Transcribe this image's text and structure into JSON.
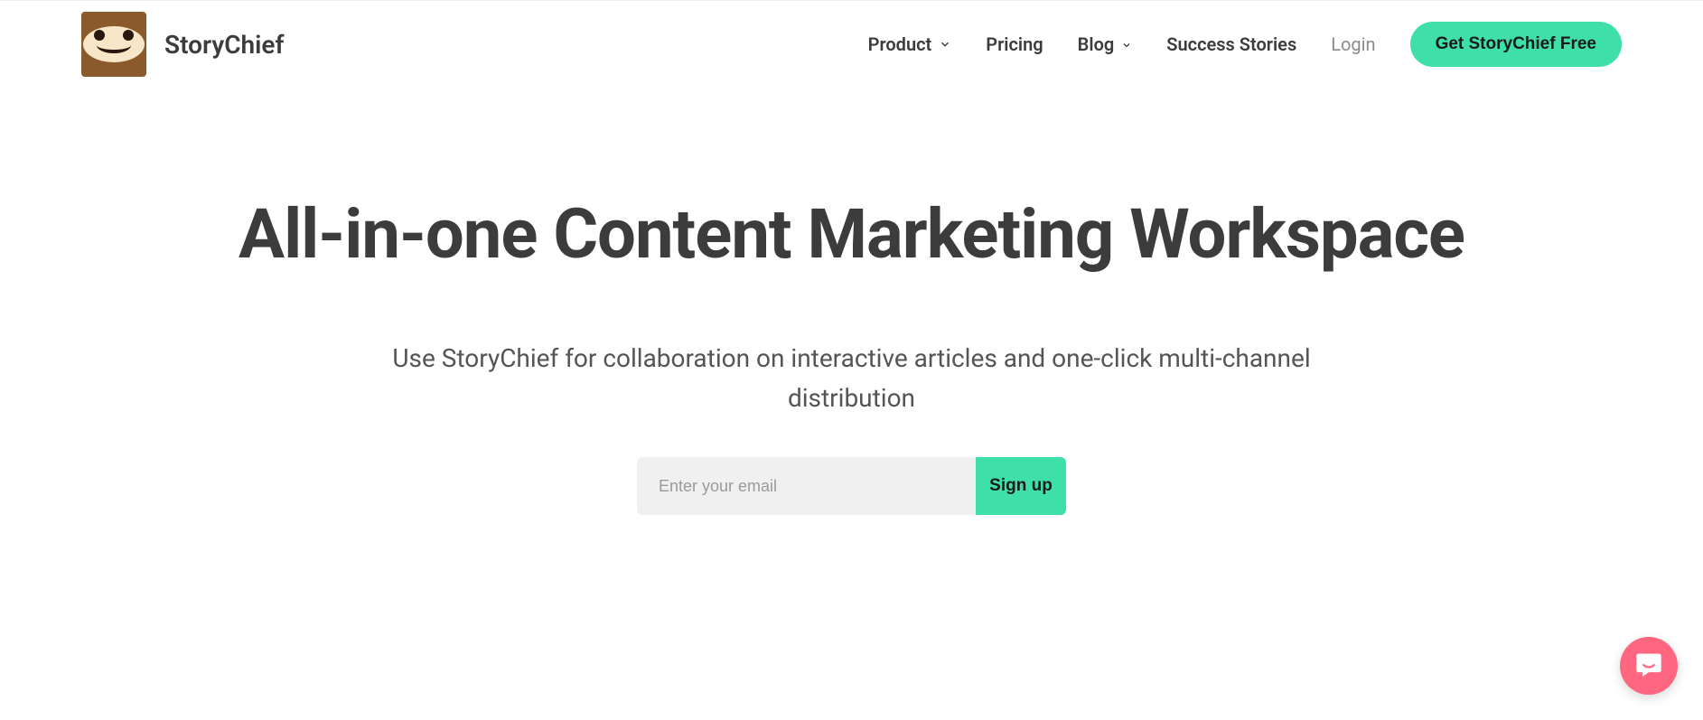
{
  "brand": {
    "name": "StoryChief"
  },
  "nav": {
    "product": "Product",
    "pricing": "Pricing",
    "blog": "Blog",
    "success_stories": "Success Stories",
    "login": "Login",
    "cta": "Get StoryChief Free"
  },
  "hero": {
    "title": "All-in-one Content Marketing Workspace",
    "subtitle": "Use StoryChief for collaboration on interactive articles and one-click multi-channel distribution"
  },
  "form": {
    "email_placeholder": "Enter your email",
    "signup_label": "Sign up"
  }
}
